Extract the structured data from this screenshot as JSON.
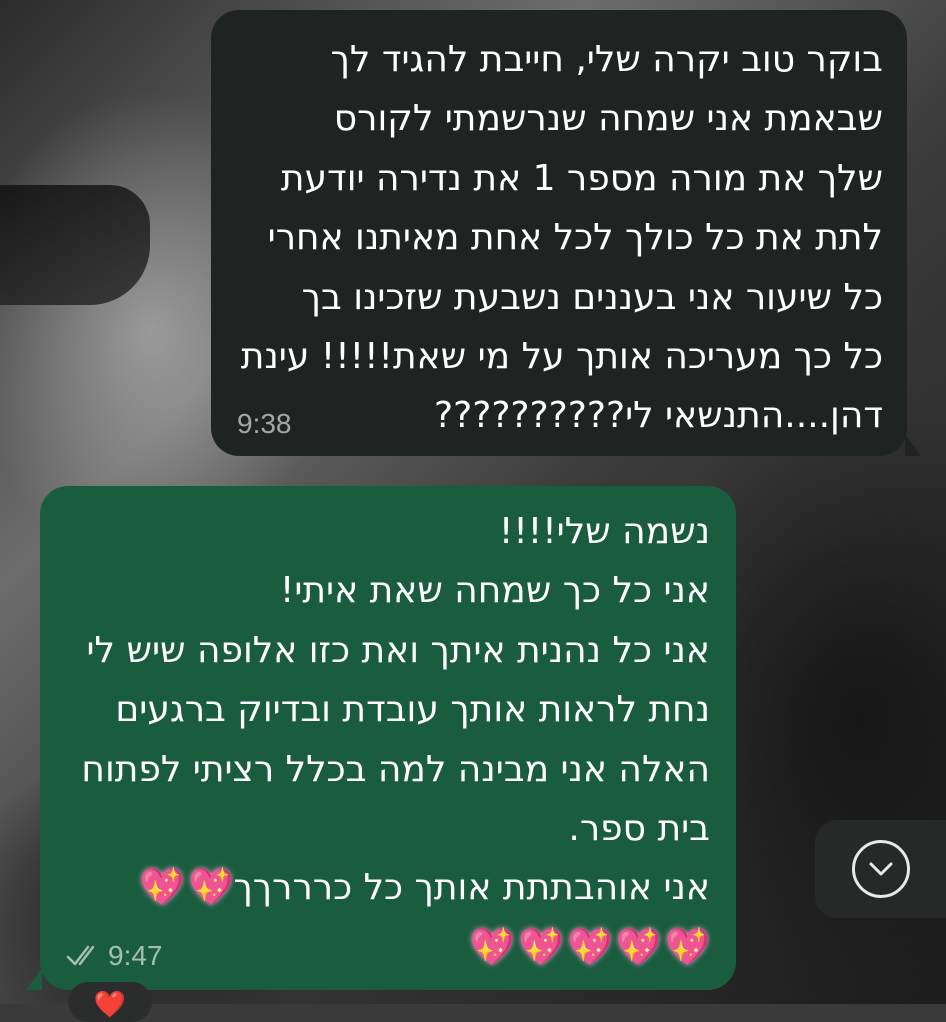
{
  "incoming_message": {
    "lines": [
      "בוקר טוב יקרה שלי, חייבת להגיד לך",
      "שבאמת אני שמחה שנרשמתי לקורס",
      "שלך את מורה מספר 1 את נדירה יודעת",
      "לתת את כל כולך לכל אחת מאיתנו  אחרי",
      "כל שיעור אני בעננים נשבעת שזכינו בך",
      "כל כך מעריכה אותך על מי שאת!!!!! עינת",
      "דהן....התנשאי לי??????????"
    ],
    "time": "9:38"
  },
  "outgoing_message": {
    "lines": [
      "נשמה שלי!!!!",
      "אני כל כך שמחה שאת איתי!",
      "אני כל נהנית איתך ואת כזו אלופה שיש לי",
      "נחת לראות אותך עובדת ובדיוק ברגעים",
      "האלה אני מבינה למה בכלל רציתי לפתוח",
      "בית ספר.",
      "אני אוהבתתת אותך כל כרררךך"
    ],
    "inline_hearts": [
      "💖",
      "💖"
    ],
    "heart_row": [
      "💖",
      "💖",
      "💖",
      "💖",
      "💖"
    ],
    "time": "9:47",
    "status_icon": "double-check-icon"
  },
  "reaction": {
    "emoji": "❤️",
    "icon": "heart-icon"
  },
  "scroll_button": {
    "icon": "chevron-down-icon"
  },
  "colors": {
    "incoming_bubble": "#1f2423",
    "outgoing_bubble": "#1a5c3e",
    "text": "#ffffff",
    "heart": "#ff4fa3"
  }
}
